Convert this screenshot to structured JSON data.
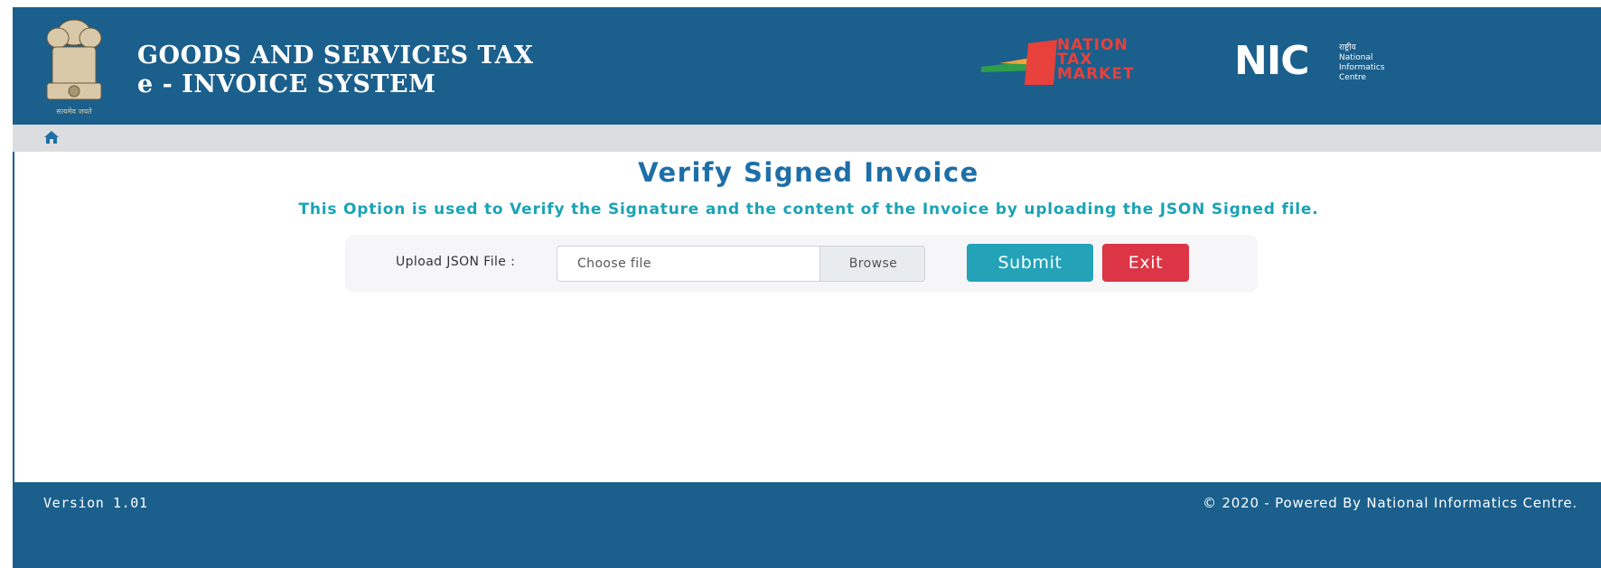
{
  "header": {
    "title_line1": "GOODS AND SERVICES TAX",
    "title_line2": "e - INVOICE SYSTEM",
    "emblem_icon": "ashoka-emblem-icon",
    "emblem_caption": "सत्यमेव जयते",
    "ntm_logo_lines": [
      "NATION",
      "TAX",
      "MARKET"
    ],
    "nic_logo_text": "NIC",
    "nic_sub_lines": [
      "राष्ट्रीय",
      "National",
      "Informatics",
      "Centre"
    ],
    "background_color": "#1b5f8c"
  },
  "breadcrumb": {
    "home_icon": "home-icon"
  },
  "main": {
    "page_title": "Verify Signed Invoice",
    "description": "This Option is used to Verify the Signature and the content of the Invoice by uploading the JSON Signed file.",
    "upload": {
      "label": "Upload JSON File :",
      "placeholder": "Choose file",
      "browse_label": "Browse"
    },
    "submit_label": "Submit",
    "exit_label": "Exit"
  },
  "footer": {
    "version": "Version 1.01",
    "copyright": "© 2020 - Powered By National Informatics Centre."
  },
  "colors": {
    "primary": "#1b5f8c",
    "title": "#1d6fa8",
    "description": "#1aa3b5",
    "submit": "#23a2b8",
    "exit": "#dc3545"
  }
}
